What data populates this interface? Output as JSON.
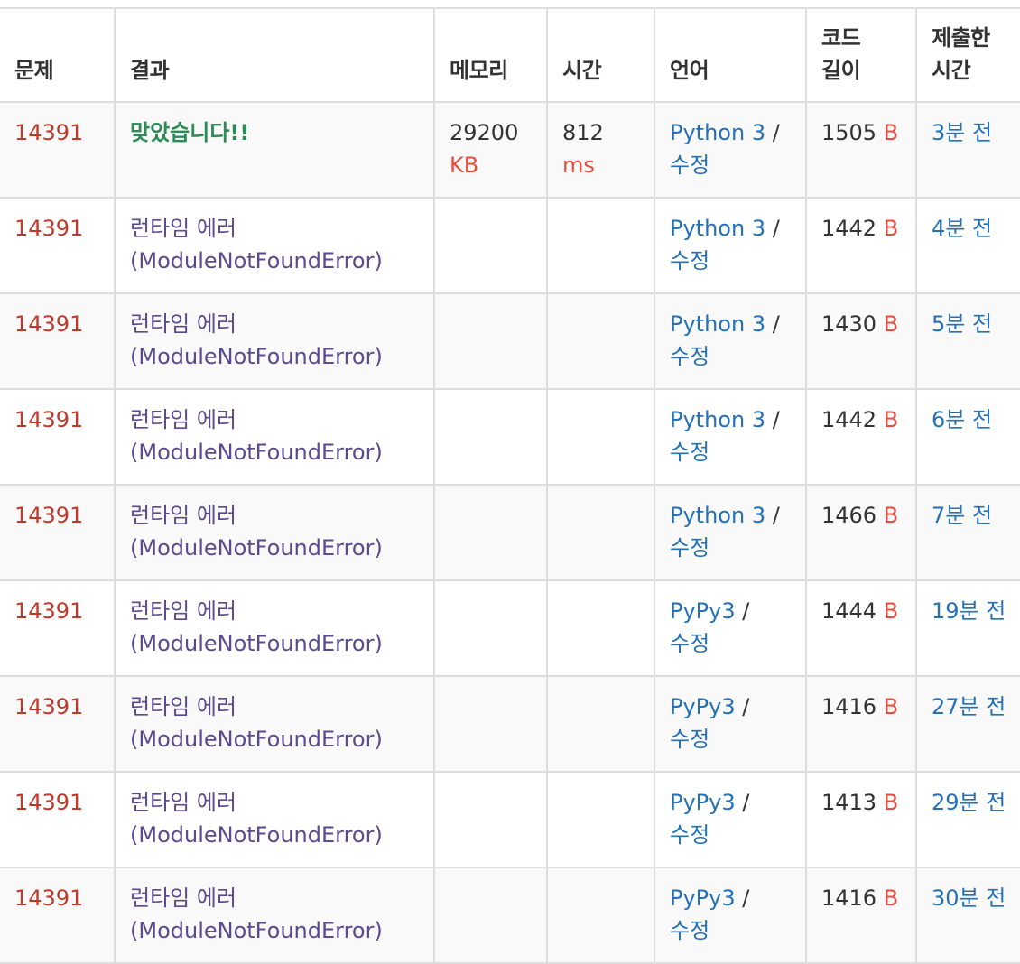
{
  "headers": {
    "problem": "문제",
    "result": "결과",
    "memory": "메모리",
    "time": "시간",
    "language": "언어",
    "code_length": "코드 길이",
    "submitted_time": "제출한 시간"
  },
  "rows": [
    {
      "problem": "14391",
      "result": "맞았습니다!!",
      "result_type": "ac",
      "memory": "29200",
      "memory_unit": "KB",
      "time": "812",
      "time_unit": "ms",
      "language": "Python 3",
      "edit": "수정",
      "length": "1505",
      "length_unit": "B",
      "submitted": "3분 전"
    },
    {
      "problem": "14391",
      "result": "런타임 에러 (ModuleNotFoundError)",
      "result_type": "rte",
      "memory": "",
      "memory_unit": "",
      "time": "",
      "time_unit": "",
      "language": "Python 3",
      "edit": "수정",
      "length": "1442",
      "length_unit": "B",
      "submitted": "4분 전"
    },
    {
      "problem": "14391",
      "result": "런타임 에러 (ModuleNotFoundError)",
      "result_type": "rte",
      "memory": "",
      "memory_unit": "",
      "time": "",
      "time_unit": "",
      "language": "Python 3",
      "edit": "수정",
      "length": "1430",
      "length_unit": "B",
      "submitted": "5분 전"
    },
    {
      "problem": "14391",
      "result": "런타임 에러 (ModuleNotFoundError)",
      "result_type": "rte",
      "memory": "",
      "memory_unit": "",
      "time": "",
      "time_unit": "",
      "language": "Python 3",
      "edit": "수정",
      "length": "1442",
      "length_unit": "B",
      "submitted": "6분 전"
    },
    {
      "problem": "14391",
      "result": "런타임 에러 (ModuleNotFoundError)",
      "result_type": "rte",
      "memory": "",
      "memory_unit": "",
      "time": "",
      "time_unit": "",
      "language": "Python 3",
      "edit": "수정",
      "length": "1466",
      "length_unit": "B",
      "submitted": "7분 전"
    },
    {
      "problem": "14391",
      "result": "런타임 에러 (ModuleNotFoundError)",
      "result_type": "rte",
      "memory": "",
      "memory_unit": "",
      "time": "",
      "time_unit": "",
      "language": "PyPy3",
      "edit": "수정",
      "length": "1444",
      "length_unit": "B",
      "submitted": "19분 전"
    },
    {
      "problem": "14391",
      "result": "런타임 에러 (ModuleNotFoundError)",
      "result_type": "rte",
      "memory": "",
      "memory_unit": "",
      "time": "",
      "time_unit": "",
      "language": "PyPy3",
      "edit": "수정",
      "length": "1416",
      "length_unit": "B",
      "submitted": "27분 전"
    },
    {
      "problem": "14391",
      "result": "런타임 에러 (ModuleNotFoundError)",
      "result_type": "rte",
      "memory": "",
      "memory_unit": "",
      "time": "",
      "time_unit": "",
      "language": "PyPy3",
      "edit": "수정",
      "length": "1413",
      "length_unit": "B",
      "submitted": "29분 전"
    },
    {
      "problem": "14391",
      "result": "런타임 에러 (ModuleNotFoundError)",
      "result_type": "rte",
      "memory": "",
      "memory_unit": "",
      "time": "",
      "time_unit": "",
      "language": "PyPy3",
      "edit": "수정",
      "length": "1416",
      "length_unit": "B",
      "submitted": "30분 전"
    }
  ],
  "colors": {
    "problem_link": "#c0392b",
    "accepted": "#2e8b57",
    "runtime_error": "#5b4a8f",
    "unit": "#e74c3c",
    "link": "#2471b8",
    "row_stripe": "#f9f9f9",
    "border": "#dddddd"
  }
}
